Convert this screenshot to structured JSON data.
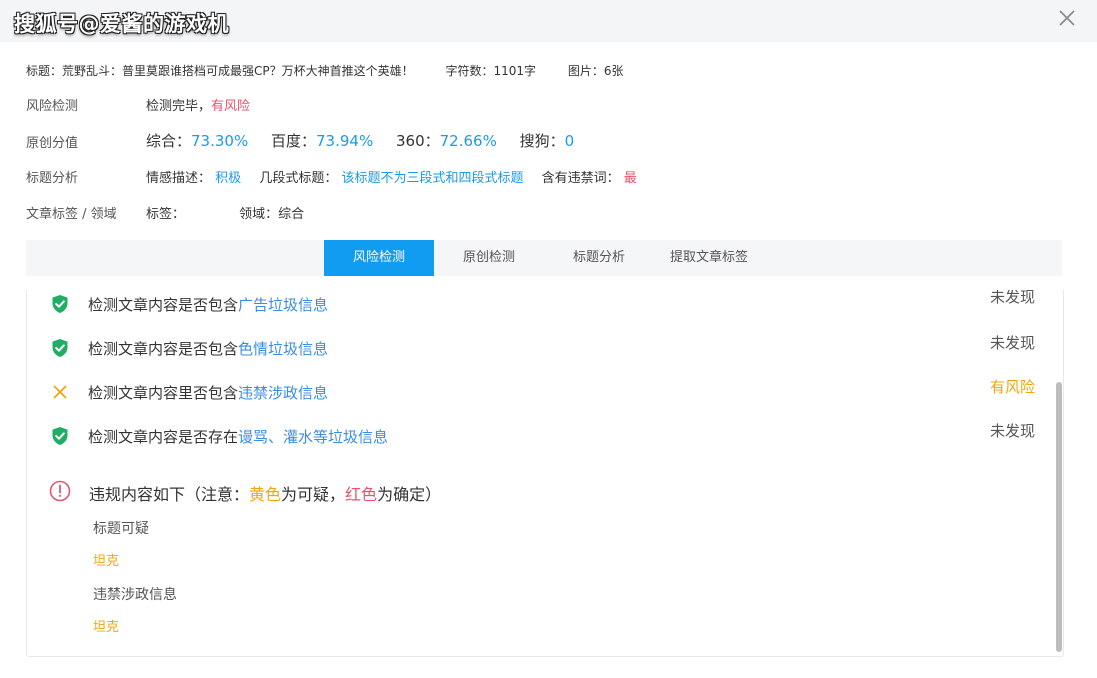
{
  "watermark": "搜狐号@爱酱的游戏机",
  "meta": {
    "title": "标题：荒野乱斗：普里莫跟谁搭档可成最强CP？万杯大神首推这个英雄！",
    "word_count": "字符数：1101字",
    "images": "图片：6张"
  },
  "risk": {
    "label": "风险检测",
    "value_prefix": "检测完毕，",
    "value_flag": "有风险"
  },
  "originality": {
    "label": "原创分值",
    "overall_label": "综合：",
    "overall_value": "73.30%",
    "baidu_label": "百度：",
    "baidu_value": "73.94%",
    "s360_label": "360：",
    "s360_value": "72.66%",
    "sogou_label": "搜狗：",
    "sogou_value": "0"
  },
  "title_analysis": {
    "label": "标题分析",
    "sentiment_label": "情感描述：",
    "sentiment_value": "积极",
    "segments_label": "几段式标题：",
    "segments_value": "该标题不为三段式和四段式标题",
    "banned_label": "含有违禁词：",
    "banned_value": "最"
  },
  "tags": {
    "label": "文章标签 / 领域",
    "tag_label": "标签：",
    "domain_label": "领域：综合"
  },
  "tabs": [
    {
      "label": "风险检测",
      "active": true
    },
    {
      "label": "原创检测",
      "active": false
    },
    {
      "label": "标题分析",
      "active": false
    },
    {
      "label": "提取文章标签",
      "active": false
    }
  ],
  "checks": [
    {
      "prefix": "检测文章内容是否包含",
      "link": "广告垃圾信息",
      "status": "未发现",
      "ok": true
    },
    {
      "prefix": "检测文章内容是否包含",
      "link": "色情垃圾信息",
      "status": "未发现",
      "ok": true
    },
    {
      "prefix": "检测文章内容里否包含",
      "link": "违禁涉政信息",
      "status": "有风险",
      "ok": false
    },
    {
      "prefix": "检测文章内容是否存在",
      "link": "谩骂、灌水等垃圾信息",
      "status": "未发现",
      "ok": true
    }
  ],
  "violations": {
    "head_prefix": "违规内容如下（注意：",
    "yellow_word": "黄色",
    "mid": "为可疑，",
    "red_word": "红色",
    "suffix": "为确定）",
    "groups": [
      {
        "label": "标题可疑",
        "value": "坦克"
      },
      {
        "label": "违禁涉政信息",
        "value": "坦克"
      }
    ]
  },
  "colors": {
    "accent": "#109cf1",
    "risk_red": "#e8546f",
    "warn_yellow": "#f2a60c",
    "ok_green": "#1fae63"
  }
}
